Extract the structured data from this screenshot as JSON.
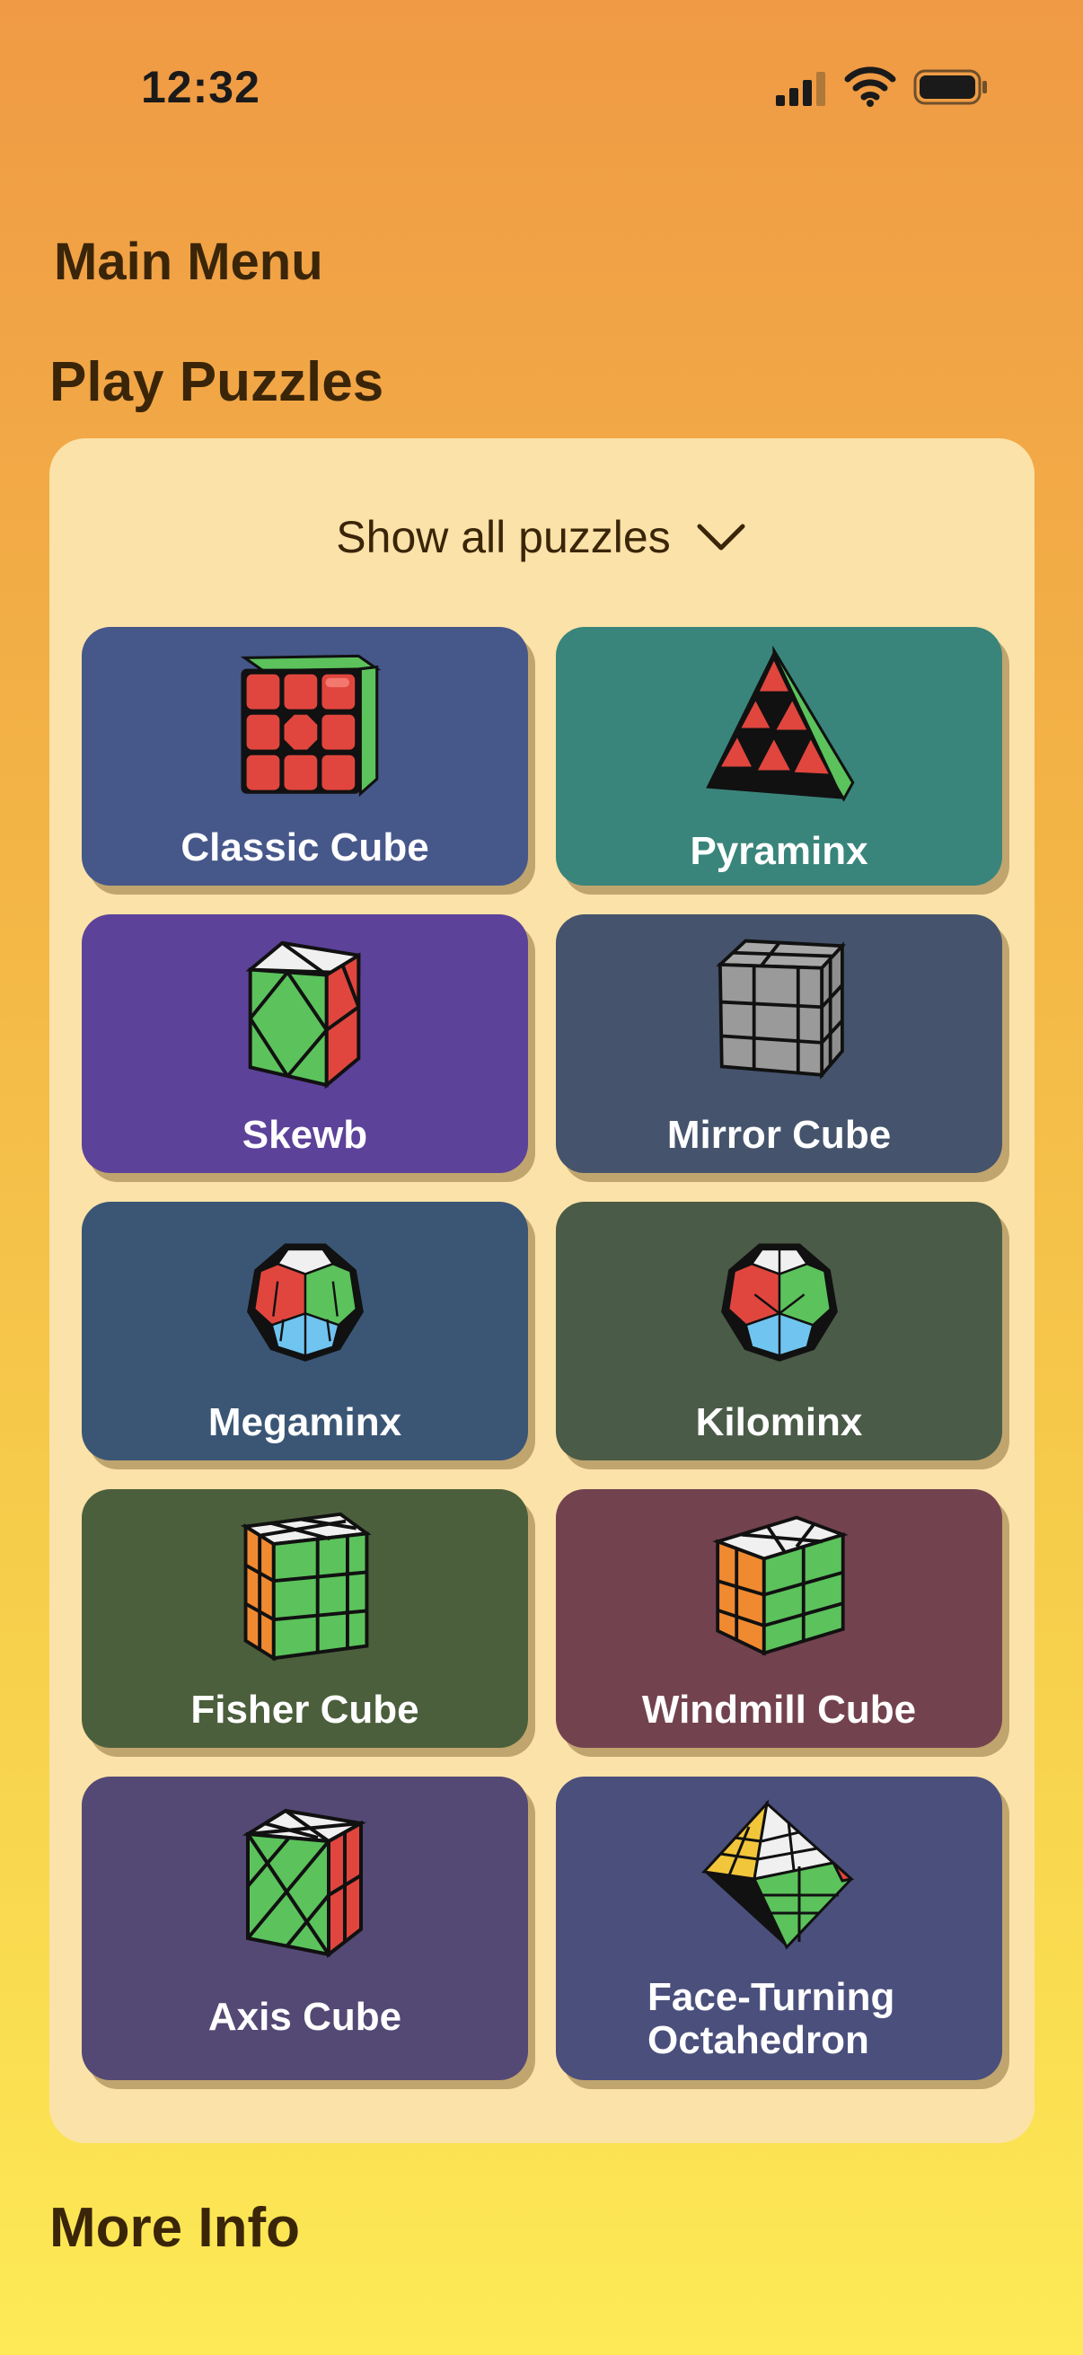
{
  "status_bar": {
    "time": "12:32"
  },
  "main_title": "Main Menu",
  "play_section": {
    "title": "Play Puzzles",
    "show_all_label": "Show all puzzles"
  },
  "puzzles": [
    {
      "label": "Classic Cube",
      "color": "#46578A"
    },
    {
      "label": "Pyraminx",
      "color": "#3A857B"
    },
    {
      "label": "Skewb",
      "color": "#5C4299"
    },
    {
      "label": "Mirror Cube",
      "color": "#45536C"
    },
    {
      "label": "Megaminx",
      "color": "#3B5675"
    },
    {
      "label": "Kilominx",
      "color": "#4A5B47"
    },
    {
      "label": "Fisher Cube",
      "color": "#4B5F3C"
    },
    {
      "label": "Windmill Cube",
      "color": "#73424F"
    },
    {
      "label": "Axis Cube",
      "color": "#544974"
    },
    {
      "label": "Face-Turning\nOctahedron",
      "color": "#4A4F7C"
    }
  ],
  "more_info": {
    "title": "More Info"
  }
}
